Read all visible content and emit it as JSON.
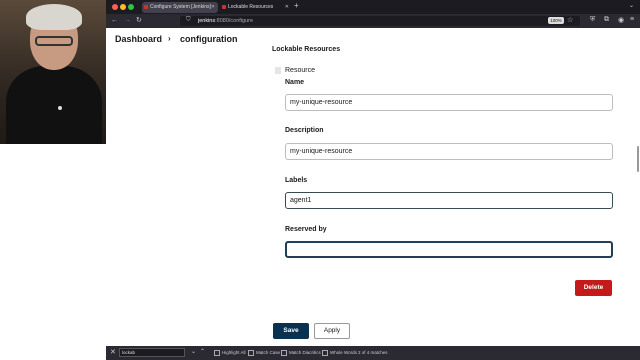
{
  "browser": {
    "tabs": [
      {
        "label": "Configure System [Jenkins]"
      },
      {
        "label": "Lockable Resources [Jenkins] - Je"
      }
    ],
    "url_host": "jenkins",
    "url_rest": ":8080/configure",
    "zoom": "100%"
  },
  "breadcrumb": {
    "dashboard": "Dashboard",
    "separator": "›",
    "configuration": "configuration"
  },
  "section": {
    "title": "Lockable Resources",
    "resource_label": "Resource"
  },
  "form": {
    "name_label": "Name",
    "name_value": "my-unique-resource",
    "description_label": "Description",
    "description_value": "my-unique-resource",
    "labels_label": "Labels",
    "labels_value": "agent1",
    "reserved_label": "Reserved by",
    "reserved_value": ""
  },
  "buttons": {
    "delete": "Delete",
    "save": "Save",
    "apply": "Apply"
  },
  "findbar": {
    "query": "lockab",
    "highlight_all": "Highlight All",
    "match_case": "Match Case",
    "match_diacritics": "Match Diacritics",
    "whole_words": "Whole Words",
    "status": "2 of 4 matches"
  }
}
